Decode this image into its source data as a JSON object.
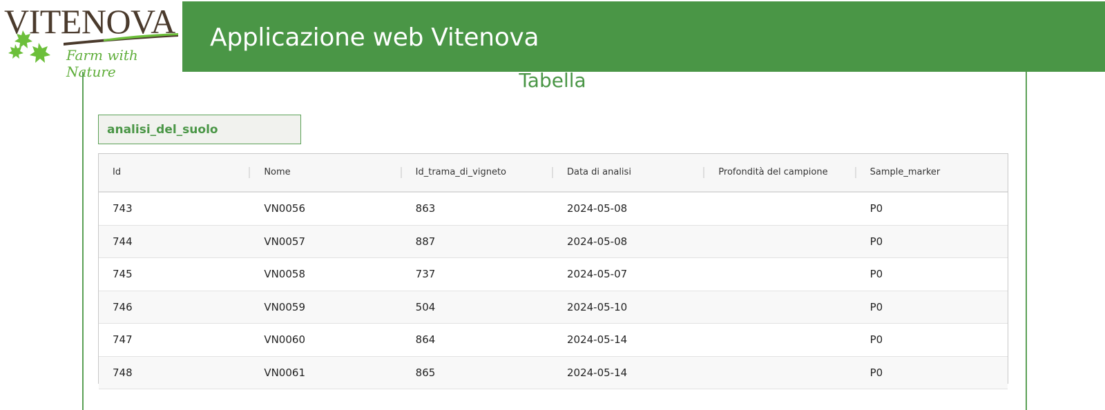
{
  "header": {
    "app_title": "Applicazione web Vitenova",
    "logo_word": "VITENOVA",
    "logo_tagline": "Farm with Nature"
  },
  "main": {
    "page_title": "Tabella",
    "table_tab_label": "analisi_del_suolo",
    "columns": [
      "Id",
      "Nome",
      "Id_trama_di_vigneto",
      "Data di analisi",
      "Profondità del campione",
      "Sample_marker"
    ],
    "rows": [
      [
        "743",
        "VN0056",
        "863",
        "2024-05-08",
        "",
        "P0"
      ],
      [
        "744",
        "VN0057",
        "887",
        "2024-05-08",
        "",
        "P0"
      ],
      [
        "745",
        "VN0058",
        "737",
        "2024-05-07",
        "",
        "P0"
      ],
      [
        "746",
        "VN0059",
        "504",
        "2024-05-10",
        "",
        "P0"
      ],
      [
        "747",
        "VN0060",
        "864",
        "2024-05-14",
        "",
        "P0"
      ],
      [
        "748",
        "VN0061",
        "865",
        "2024-05-14",
        "",
        "P0"
      ]
    ]
  },
  "colors": {
    "brand_green": "#4a9646",
    "logo_brown": "#4a3a2c",
    "leaf_green": "#6cbf3a"
  }
}
